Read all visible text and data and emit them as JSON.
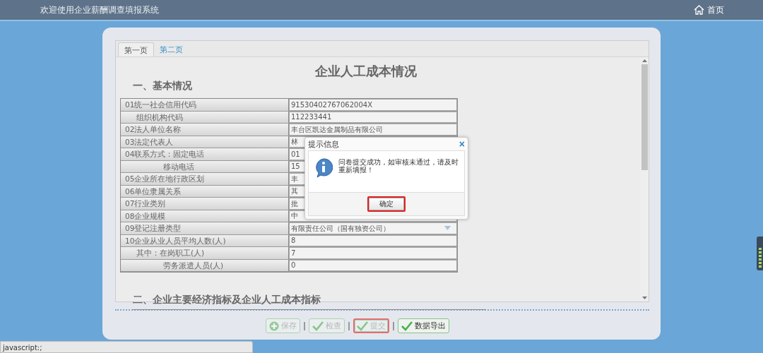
{
  "header": {
    "title": "欢迎使用企业薪酬调查填报系统",
    "home_link": "首页"
  },
  "tabs": [
    {
      "label": "第一页",
      "selected": true
    },
    {
      "label": "第二页",
      "selected": false
    }
  ],
  "form": {
    "title": "企业人工成本情况",
    "section_1": "一、基本情况",
    "rows": [
      {
        "label": "01统一社会信用代码",
        "value": "91530402767062004X",
        "kind": "main"
      },
      {
        "label": "组织机构代码",
        "value": "112233441",
        "kind": "sub"
      },
      {
        "label": "02法人单位名称",
        "value": "丰台区凯达金属制品有限公司",
        "kind": "main"
      },
      {
        "label": "03法定代表人",
        "value": "林",
        "kind": "main"
      },
      {
        "label": "04联系方式：固定电话",
        "value": "01",
        "kind": "main"
      },
      {
        "label": "移动电话",
        "value": "15",
        "kind": "deep"
      },
      {
        "label": "05企业所在地行政区划",
        "value": "丰",
        "kind": "main"
      },
      {
        "label": "06单位隶属关系",
        "value": "其",
        "kind": "main"
      },
      {
        "label": "07行业类别",
        "value": "批",
        "kind": "main"
      },
      {
        "label": "08企业规模",
        "value": "中",
        "kind": "main"
      },
      {
        "label": "09登记注册类型",
        "value": "有限责任公司（国有独资公司）",
        "kind": "select"
      },
      {
        "label": "10企业从业人员平均人数(人)",
        "value": "8",
        "kind": "main"
      },
      {
        "label": "其中：在岗职工(人)",
        "value": "7",
        "kind": "sub"
      },
      {
        "label": "劳务派遣人员(人)",
        "value": "0",
        "kind": "deep"
      }
    ],
    "section_2": "二、企业主要经济指标及企业人工成本指标"
  },
  "actions": [
    {
      "label": "保存",
      "kind": "add",
      "disabled": true,
      "highlighted": false
    },
    {
      "label": "检查",
      "kind": "check",
      "disabled": true,
      "highlighted": false
    },
    {
      "label": "提交",
      "kind": "check",
      "disabled": true,
      "highlighted": true
    },
    {
      "label": "数据导出",
      "kind": "check",
      "disabled": false,
      "highlighted": false
    }
  ],
  "dialog": {
    "title": "提示信息",
    "close": "×",
    "message": "问卷提交成功，如审核未通过，请及时重新填报！",
    "ok_button": "确定",
    "ok_highlighted": true
  },
  "status_bar": "javascript:;"
}
